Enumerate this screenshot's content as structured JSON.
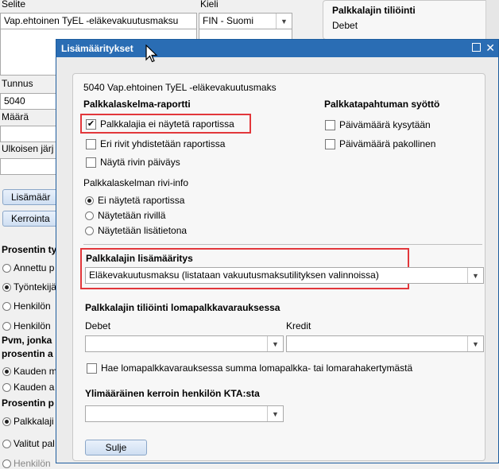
{
  "background": {
    "selite_label": "Selite",
    "selite_value": "Vap.ehtoinen TyEL -eläkevakuutusmaksu",
    "kieli_label": "Kieli",
    "kieli_value": "FIN - Suomi",
    "right_group_title": "Palkkalajin tiliöinti",
    "right_debet_label": "Debet",
    "tunnus_label": "Tunnus",
    "tunnus_value": "5040",
    "maara_label": "Määrä",
    "ulkoisen_label": "Ulkoisen järj",
    "lisamaar_btn": "Lisämäär",
    "kerrointa_btn": "Kerrointa",
    "prosentin_ty": "Prosentin ty",
    "annettu_p": "Annettu p",
    "tyontekija": "Työntekijä",
    "henkilon1": "Henkilön",
    "henkilon2": "Henkilön",
    "pvm_jonka": "Pvm, jonka",
    "prosentin_a": "prosentin a",
    "kauden_m": "Kauden m",
    "kauden_a": "Kauden a",
    "prosentin_p": "Prosentin p",
    "palkkalaji": "Palkkalaji",
    "valitut_pal": "Valitut pal",
    "henkilon3": "Henkilön"
  },
  "dialog": {
    "title": "Lisämääritykset",
    "heading": "5040 Vap.ehtoinen TyEL -eläkevakuutusmaks",
    "report_section": "Palkkalaskelma-raportti",
    "cb_hidden": "Palkkalajia ei näytetä raportissa",
    "cb_rows": "Eri rivit yhdistetään raportissa",
    "cb_date": "Näytä rivin päiväys",
    "event_section": "Palkkatapahtuman syöttö",
    "cb_ask_date": "Päivämäärä kysytään",
    "cb_req_date": "Päivämäärä pakollinen",
    "rowinfo_label": "Palkkalaskelman rivi-info",
    "radio_hidden": "Ei näytetä raportissa",
    "radio_row": "Näytetään rivillä",
    "radio_extra": "Näytetään lisätietona",
    "definition_section": "Palkkalajin lisämääritys",
    "definition_value": "Eläkevakuutusmaksu (listataan vakuutusmaksutilityksen valinnoissa)",
    "accounting_section": "Palkkalajin tiliöinti lomapalkkavarauksessa",
    "debet_label": "Debet",
    "kredit_label": "Kredit",
    "debet_value": "",
    "kredit_value": "",
    "cb_holiday": "Hae lomapalkkavarauksessa summa lomapalkka- tai lomarahakertymästä",
    "kta_section": "Ylimääräinen kerroin henkilön KTA:sta",
    "kta_value": "",
    "close_button": "Sulje",
    "checked": {
      "hidden": true,
      "rows": false,
      "date": false,
      "ask_date": false,
      "req_date": false,
      "holiday": false
    },
    "radio_selected": "hidden"
  },
  "colors": {
    "title_bar": "#2a6db4",
    "highlight_box": "#e2373b"
  }
}
